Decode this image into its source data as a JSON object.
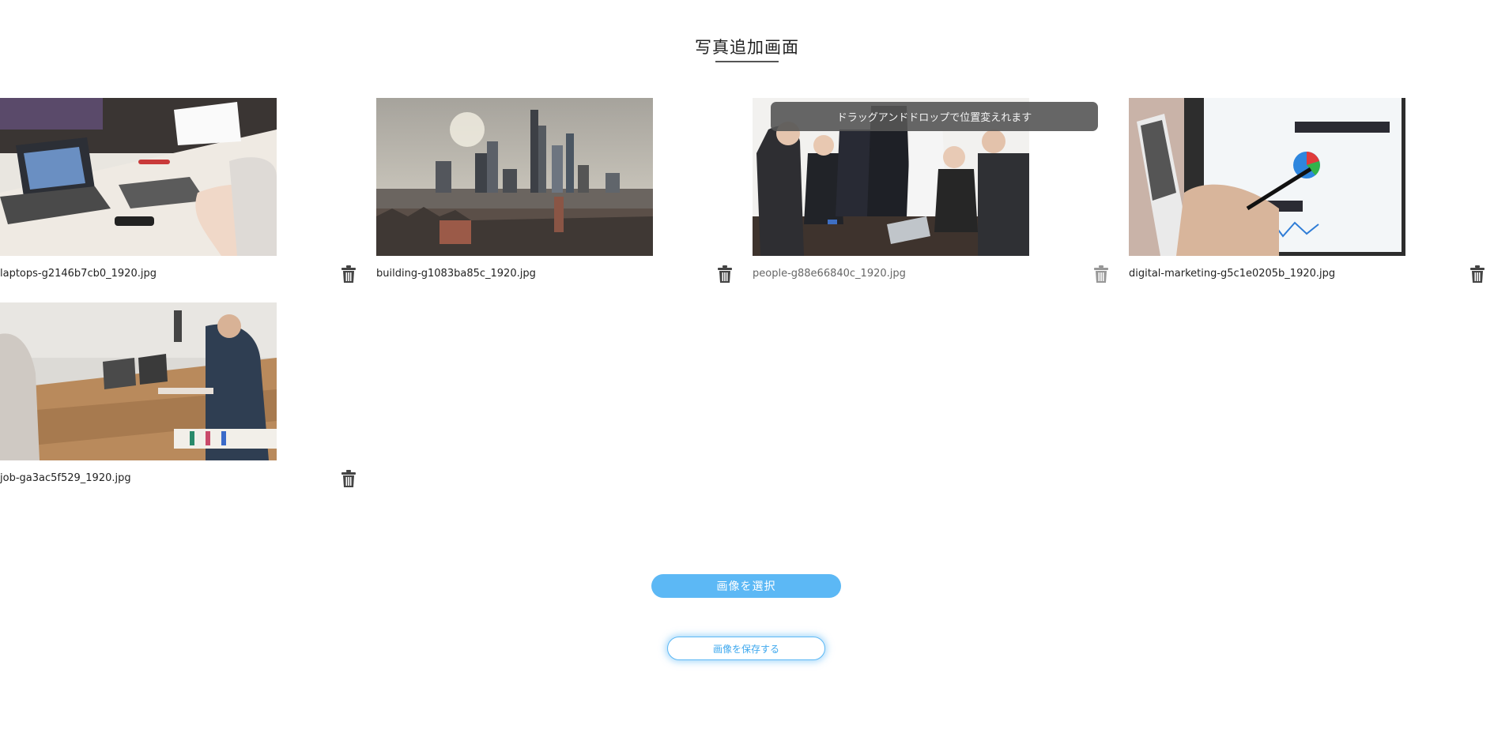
{
  "page": {
    "title": "写真追加画面"
  },
  "photos": [
    {
      "filename": "laptops-g2146b7cb0_1920.jpg",
      "image": "office-laptops-meeting-photo"
    },
    {
      "filename": "building-g1083ba85c_1920.jpg",
      "image": "city-skyline-buildings-photo"
    },
    {
      "filename": "people-g88e66840c_1920.jpg",
      "image": "business-people-handshake-photo"
    },
    {
      "filename": "digital-marketing-g5c1e0205b_1920.jpg",
      "image": "tablet-analytics-chart-photo"
    },
    {
      "filename": "job-ga3ac5f529_1920.jpg",
      "image": "team-table-laptops-photo"
    }
  ],
  "tooltip": {
    "text": "ドラッグアンドドロップで位置変えれます"
  },
  "buttons": {
    "select_label": "画像を選択",
    "save_label": "画像を保存する"
  },
  "icons": {
    "delete": "trash-icon"
  },
  "colors": {
    "accent": "#5cb8f5",
    "tooltip_bg": "#555555"
  }
}
